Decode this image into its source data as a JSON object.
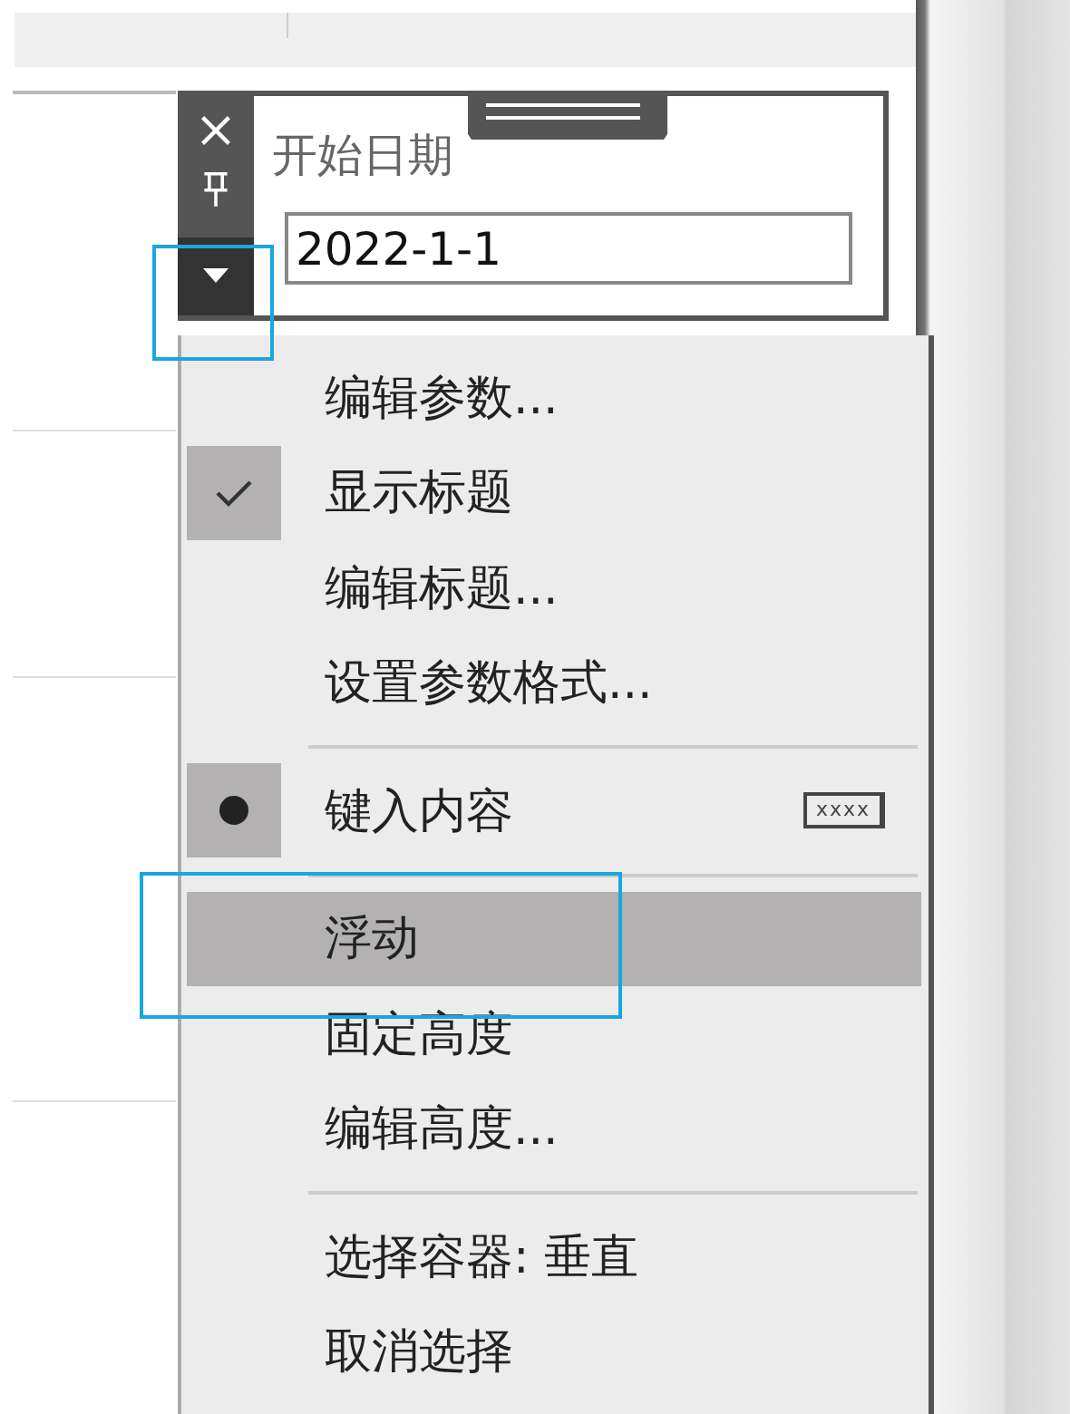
{
  "parameter_card": {
    "title": "开始日期",
    "value": "2022-1-1"
  },
  "menu": {
    "items": [
      {
        "kind": "command",
        "label": "编辑参数...",
        "highlighted": false
      },
      {
        "kind": "check",
        "label": "显示标题",
        "checked": true,
        "highlighted": false
      },
      {
        "kind": "command",
        "label": "编辑标题...",
        "highlighted": false
      },
      {
        "kind": "command",
        "label": "设置参数格式...",
        "highlighted": false
      },
      {
        "kind": "separator"
      },
      {
        "kind": "radio",
        "label": "键入内容",
        "checked": true,
        "highlighted": false,
        "sample": "xxxx"
      },
      {
        "kind": "separator"
      },
      {
        "kind": "command",
        "label": "浮动",
        "highlighted": true
      },
      {
        "kind": "command",
        "label": "固定高度",
        "highlighted": false
      },
      {
        "kind": "command",
        "label": "编辑高度...",
        "highlighted": false
      },
      {
        "kind": "separator"
      },
      {
        "kind": "command",
        "label": "选择容器: 垂直",
        "highlighted": false
      },
      {
        "kind": "command",
        "label": "取消选择",
        "highlighted": false
      }
    ]
  }
}
